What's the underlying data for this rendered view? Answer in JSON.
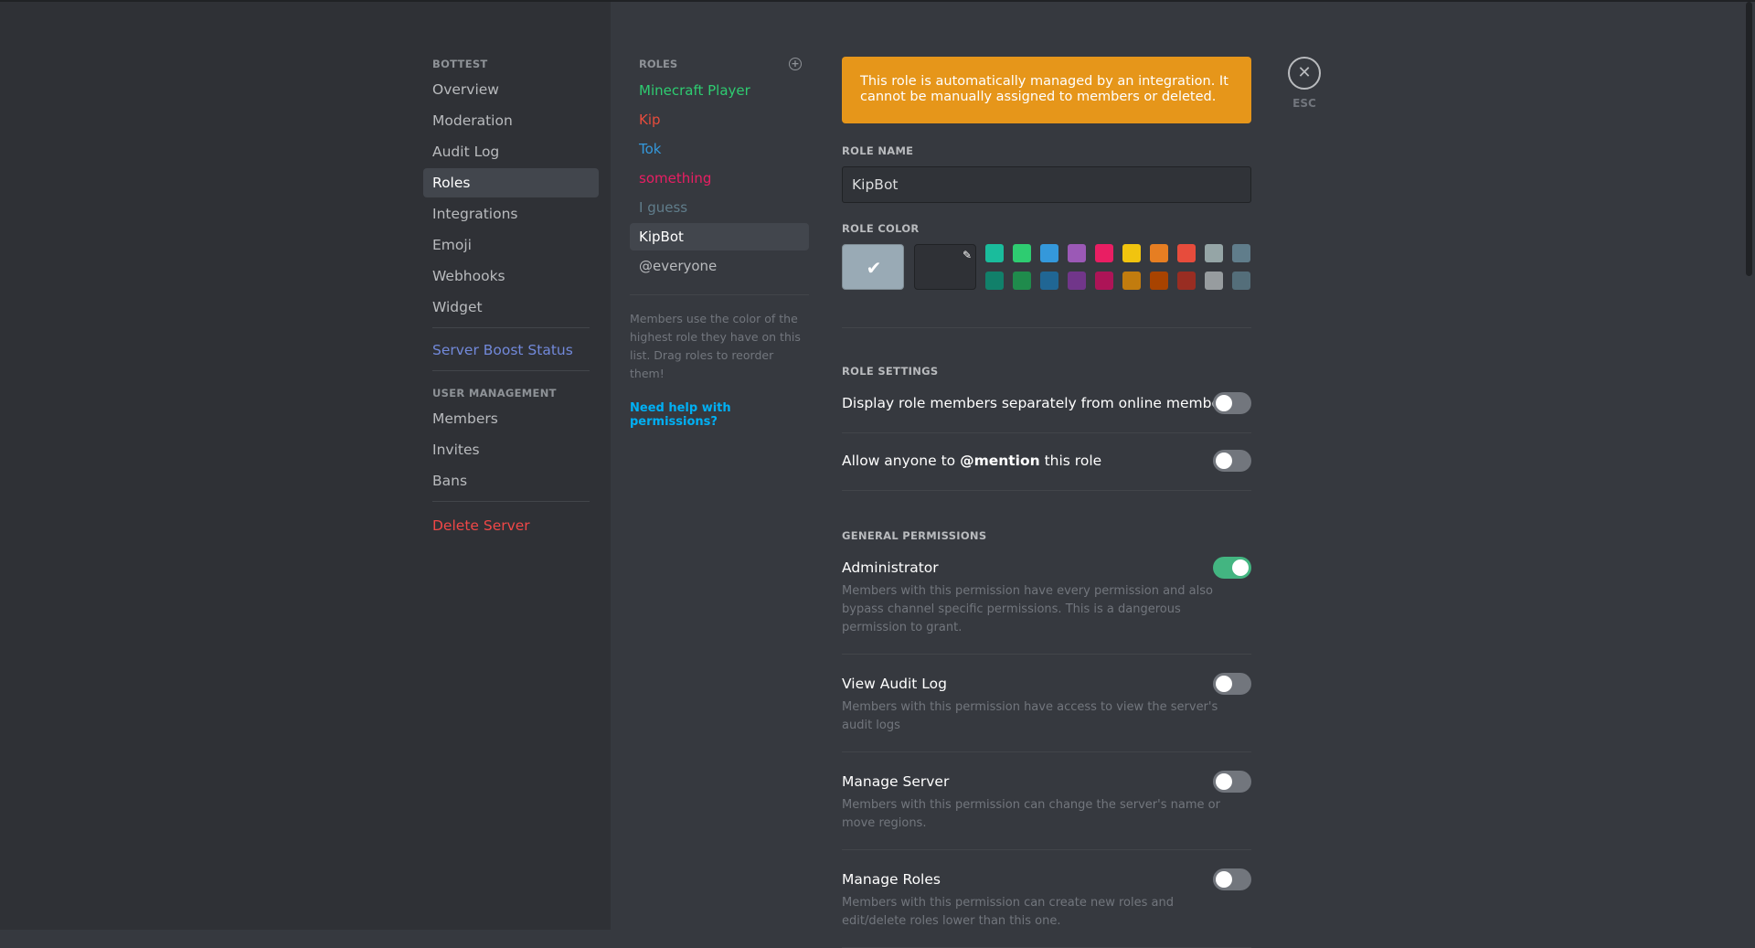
{
  "nav": {
    "server_header": "BOTTEST",
    "items": [
      "Overview",
      "Moderation",
      "Audit Log",
      "Roles",
      "Integrations",
      "Emoji",
      "Webhooks",
      "Widget"
    ],
    "boost": "Server Boost Status",
    "user_mgmt_header": "USER MANAGEMENT",
    "user_items": [
      "Members",
      "Invites",
      "Bans"
    ],
    "delete": "Delete Server"
  },
  "roles": {
    "header": "ROLES",
    "items": [
      {
        "label": "Minecraft Player",
        "color": "#2ecc71"
      },
      {
        "label": "Kip",
        "color": "#e74c3c"
      },
      {
        "label": "Tok",
        "color": "#3498db"
      },
      {
        "label": "something",
        "color": "#e91e63"
      },
      {
        "label": "I guess",
        "color": "#607d8b"
      },
      {
        "label": "KipBot",
        "color": "#ffffff"
      },
      {
        "label": "@everyone",
        "color": "#b9bbbe"
      }
    ],
    "help_text": "Members use the color of the highest role they have on this list. Drag roles to reorder them!",
    "help_link": "Need help with permissions?"
  },
  "notice": "This role is automatically managed by an integration. It cannot be manually assigned to members or deleted.",
  "role_name": {
    "label": "ROLE NAME",
    "value": "KipBot"
  },
  "role_color": {
    "label": "ROLE COLOR",
    "selected": "#99aab5",
    "palette_top": [
      "#1abc9c",
      "#2ecc71",
      "#3498db",
      "#9b59b6",
      "#e91e63",
      "#f1c40f",
      "#e67e22",
      "#e74c3c",
      "#95a5a6",
      "#607d8b"
    ],
    "palette_bottom": [
      "#11806a",
      "#1f8b4c",
      "#206694",
      "#71368a",
      "#ad1457",
      "#c27c0e",
      "#a84300",
      "#992d22",
      "#979c9f",
      "#546e7a"
    ]
  },
  "role_settings": {
    "label": "ROLE SETTINGS",
    "display_separately": "Display role members separately from online members",
    "mention_prefix": "Allow anyone to ",
    "mention_bold": "@mention",
    "mention_suffix": " this role"
  },
  "general_permissions": {
    "label": "GENERAL PERMISSIONS",
    "items": [
      {
        "title": "Administrator",
        "desc": "Members with this permission have every permission and also bypass channel specific permissions. This is a dangerous permission to grant.",
        "enabled": true
      },
      {
        "title": "View Audit Log",
        "desc": "Members with this permission have access to view the server's audit logs",
        "enabled": false
      },
      {
        "title": "Manage Server",
        "desc": "Members with this permission can change the server's name or move regions.",
        "enabled": false
      },
      {
        "title": "Manage Roles",
        "desc": "Members with this permission can create new roles and edit/delete roles lower than this one.",
        "enabled": false
      }
    ]
  },
  "close": {
    "icon": "close-icon",
    "esc_label": "ESC"
  }
}
